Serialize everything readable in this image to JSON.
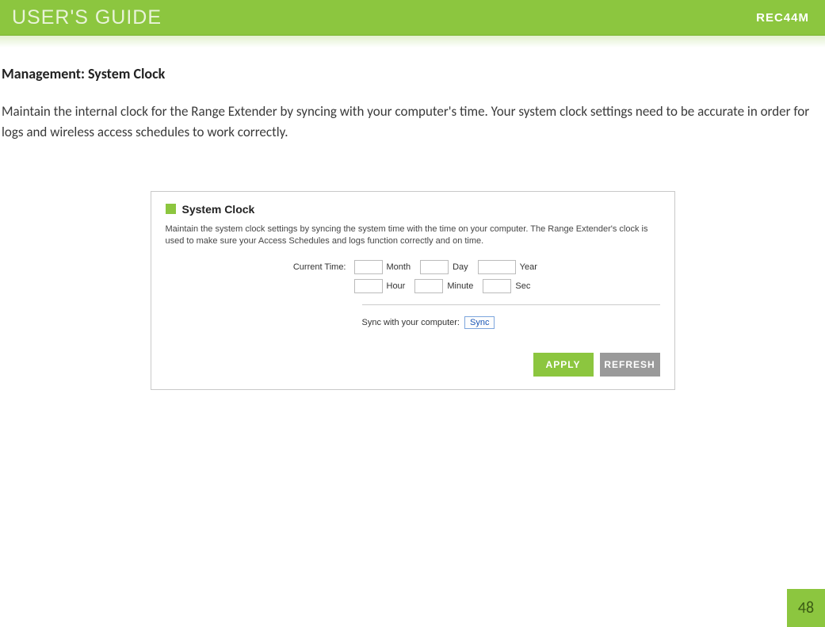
{
  "header": {
    "guide_title": "USER'S GUIDE",
    "model": "REC44M"
  },
  "section": {
    "title": "Management: System Clock",
    "description": "Maintain the internal clock for the Range Extender by syncing with your computer's time. Your system clock settings need to be accurate in order for logs and wireless access schedules to work correctly."
  },
  "panel": {
    "title": "System Clock",
    "description": "Maintain the system clock settings by syncing the system time with the time on your computer. The Range Extender's clock is used to make sure your Access Schedules and logs function correctly and on time.",
    "current_time_label": "Current Time:",
    "fields": {
      "month": {
        "label": "Month",
        "value": ""
      },
      "day": {
        "label": "Day",
        "value": ""
      },
      "year": {
        "label": "Year",
        "value": ""
      },
      "hour": {
        "label": "Hour",
        "value": ""
      },
      "minute": {
        "label": "Minute",
        "value": ""
      },
      "sec": {
        "label": "Sec",
        "value": ""
      }
    },
    "sync_label": "Sync with your computer:",
    "sync_button": "Sync",
    "apply_button": "APPLY",
    "refresh_button": "REFRESH"
  },
  "page_number": "48"
}
